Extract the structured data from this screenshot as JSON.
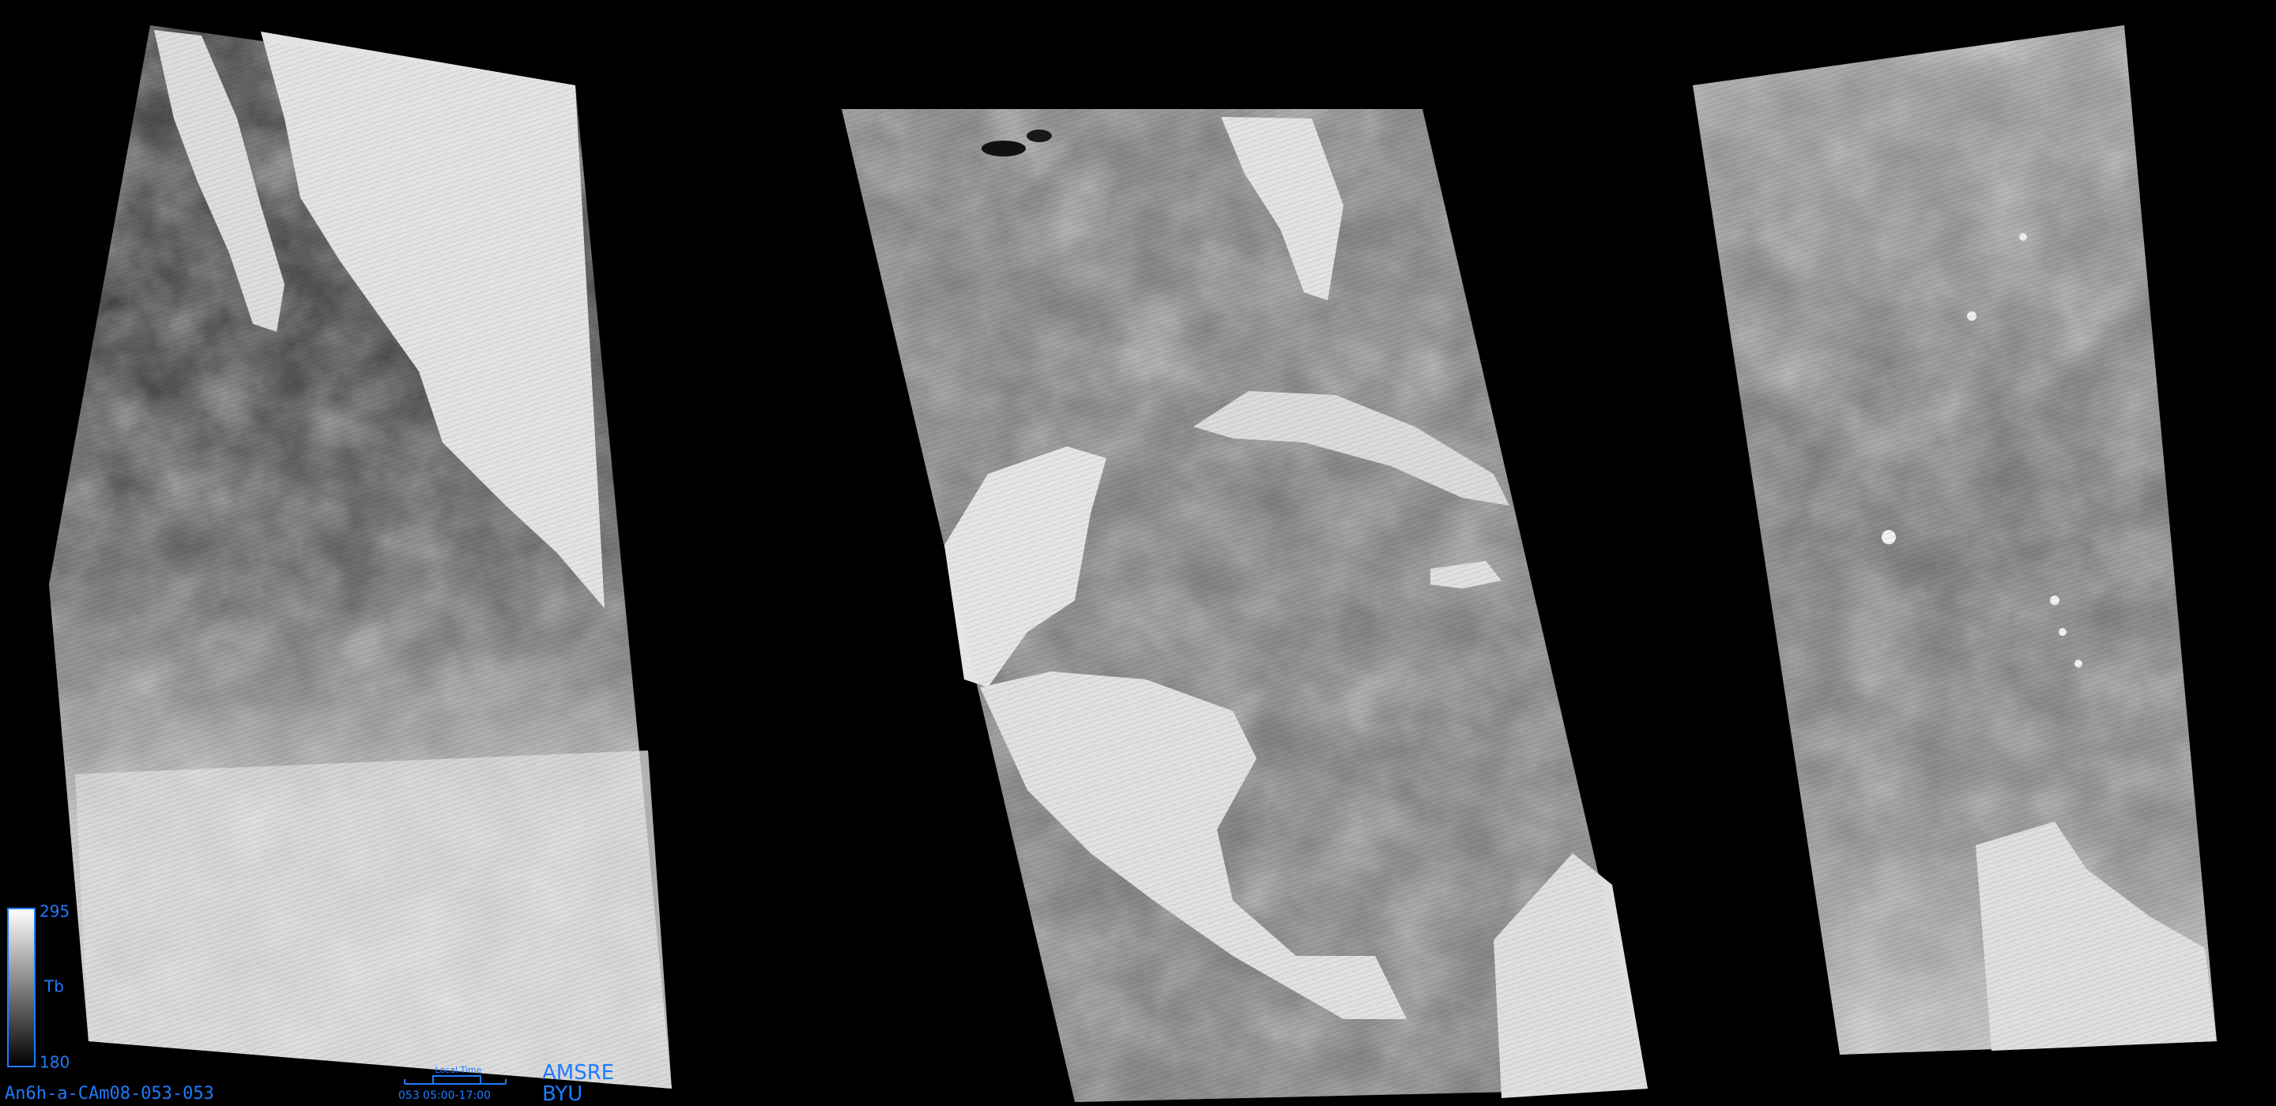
{
  "product_id": "An6h-a-CAm08-053-053",
  "colorbar": {
    "max_label": "295",
    "min_label": "180",
    "variable_label": "Tb"
  },
  "time_legend": {
    "title": "Local Time",
    "range_label": "053 05:00-17:00"
  },
  "sensor_label": "AMSRE",
  "institution_label": "BYU",
  "colors": {
    "background": "#000000",
    "annotation_blue": "#1f7bff",
    "ocean_dark": "#141414",
    "ocean_mid": "#6e6e6e",
    "land_bright": "#eeeeee"
  }
}
